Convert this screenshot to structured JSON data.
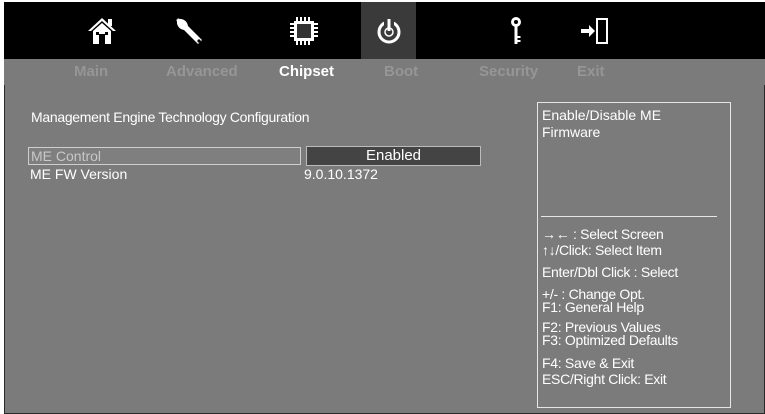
{
  "iconbar": {
    "icons": [
      {
        "name": "home-icon",
        "active": false
      },
      {
        "name": "wrench-icon",
        "active": false
      },
      {
        "name": "chip-icon",
        "active": false
      },
      {
        "name": "power-icon",
        "active": true
      },
      {
        "name": "key-icon",
        "active": false
      },
      {
        "name": "exit-door-icon",
        "active": false
      }
    ]
  },
  "tabs": [
    {
      "label": "Main",
      "active": false
    },
    {
      "label": "Advanced",
      "active": false
    },
    {
      "label": "Chipset",
      "active": true
    },
    {
      "label": "Boot",
      "active": false
    },
    {
      "label": "Security",
      "active": false
    },
    {
      "label": "Exit",
      "active": false
    }
  ],
  "main": {
    "section_title": "Management Engine Technology Configuration",
    "items": [
      {
        "label": "ME Control",
        "value": "Enabled",
        "selected": true
      },
      {
        "label": "ME FW Version",
        "value": "9.0.10.1372",
        "selected": false
      }
    ]
  },
  "help": {
    "description": "Enable/Disable ME Firmware",
    "lines": [
      "→←  : Select Screen",
      "↑↓/Click: Select Item",
      "Enter/Dbl Click : Select",
      "+/- : Change Opt.",
      "F1: General Help",
      "F2: Previous Values",
      "F3: Optimized Defaults",
      "F4: Save & Exit",
      "ESC/Right Click: Exit"
    ]
  },
  "colors": {
    "background": "#7b7b7b",
    "iconbar": "#000000",
    "active_tab": "#ffffff",
    "inactive_tab": "#969696",
    "value_box": "#444444"
  }
}
